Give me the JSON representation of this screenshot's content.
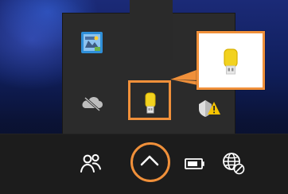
{
  "tray": {
    "notification_overflow": {
      "icons": [
        {
          "name": "intel-graphics-icon"
        },
        {
          "name": "bluetooth-icon"
        },
        {
          "name": "onedrive-icon"
        },
        {
          "name": "usb-drive-icon"
        },
        {
          "name": "security-warning-icon"
        }
      ]
    }
  },
  "taskbar": {
    "icons": [
      {
        "name": "people-icon"
      },
      {
        "name": "show-hidden-icons-chevron-icon"
      },
      {
        "name": "battery-icon"
      },
      {
        "name": "network-icon"
      }
    ]
  },
  "colors": {
    "accent_orange": "#f0903a",
    "flyout_bg": "#2b2b2b",
    "taskbar_bg": "#1c1c1c",
    "bluetooth_blue": "#0a76e8",
    "usb_yellow": "#f2d21f",
    "warning_yellow": "#f6c400"
  }
}
